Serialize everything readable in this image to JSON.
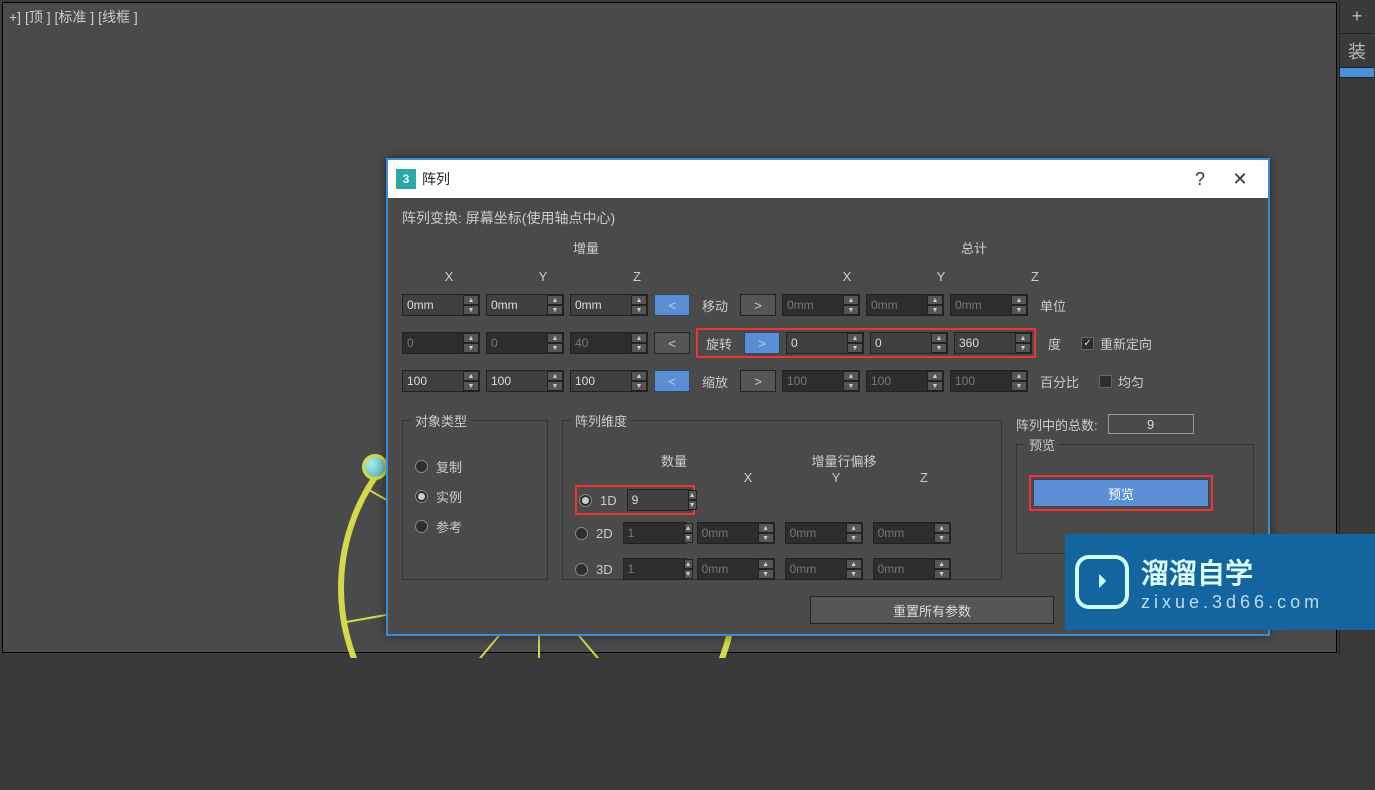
{
  "viewport_label": "+] [顶 ] [标准 ] [线框 ]",
  "sidebar": {
    "plus": "+",
    "label2": "装"
  },
  "dialog": {
    "title": "阵列",
    "transform_title": "阵列变换:  屏幕坐标(使用轴点中心)",
    "inc_label": "增量",
    "total_label": "总计",
    "axis_x": "X",
    "axis_y": "Y",
    "axis_z": "Z",
    "move": {
      "label": "移动",
      "inc_x": "0mm",
      "inc_y": "0mm",
      "inc_z": "0mm",
      "tot_x": "0mm",
      "tot_y": "0mm",
      "tot_z": "0mm",
      "unit": "单位"
    },
    "rotate": {
      "label": "旋转",
      "inc_x": "0",
      "inc_y": "0",
      "inc_z": "40",
      "tot_x": "0",
      "tot_y": "0",
      "tot_z": "360",
      "unit": "度",
      "reorient_label": "重新定向"
    },
    "scale": {
      "label": "缩放",
      "inc_x": "100",
      "inc_y": "100",
      "inc_z": "100",
      "tot_x": "100",
      "tot_y": "100",
      "tot_z": "100",
      "unit": "百分比",
      "uniform_label": "均匀"
    },
    "obj_type": {
      "legend": "对象类型",
      "copy": "复制",
      "instance": "实例",
      "reference": "参考"
    },
    "dim": {
      "legend": "阵列维度",
      "count_head": "数量",
      "offset_head": "增量行偏移",
      "x": "X",
      "y": "Y",
      "z": "Z",
      "d1": {
        "label": "1D",
        "count": "9"
      },
      "d2": {
        "label": "2D",
        "count": "1",
        "x": "0mm",
        "y": "0mm",
        "z": "0mm"
      },
      "d3": {
        "label": "3D",
        "count": "1",
        "x": "0mm",
        "y": "0mm",
        "z": "0mm"
      }
    },
    "total_in_array_label": "阵列中的总数:",
    "total_in_array": "9",
    "preview_legend": "预览",
    "preview_btn": "预览",
    "reset_btn": "重置所有参数",
    "help": "?",
    "close": "✕"
  },
  "watermark": {
    "title": "溜溜自学",
    "sub": "zixue.3d66.com",
    "play": "⏵"
  }
}
